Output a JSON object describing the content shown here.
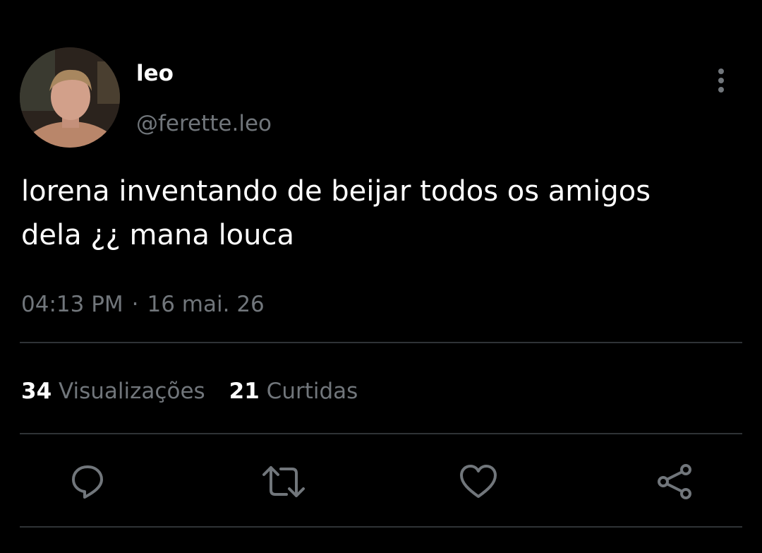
{
  "author": {
    "display_name": "leo",
    "handle": "@ferette.leo",
    "avatar_icon": "user-photo-avatar"
  },
  "tweet": {
    "text": "lorena inventando de beijar todos os amigos\ndela ¿¿ mana louca",
    "time": "04:13 PM",
    "separator": "·",
    "date": "16 mai. 26"
  },
  "stats": {
    "views_count": "34",
    "views_label": "Visualizações",
    "likes_count": "21",
    "likes_label": "Curtidas"
  },
  "icons": {
    "more": "more-vertical-icon",
    "reply": "reply-icon",
    "retweet": "retweet-icon",
    "like": "heart-icon",
    "share": "share-icon"
  },
  "colors": {
    "background": "#000000",
    "text_primary": "#ffffff",
    "text_secondary": "#71767b",
    "divider": "#2f3336"
  }
}
